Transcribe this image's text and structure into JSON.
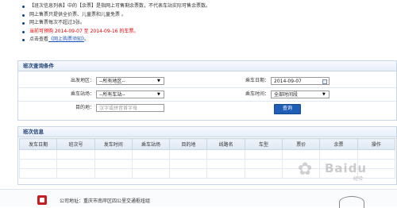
{
  "notices": [
    {
      "text": "【班次信息列表】中的【余票】是指网上可售剩余票数，不代表车站实际可售余票数。",
      "style": "normal"
    },
    {
      "text": "网上售票只提供全价票、儿童票和儿童免票 。",
      "style": "normal"
    },
    {
      "text": "网上售票每次不超过3张。",
      "style": "normal"
    },
    {
      "text": "当前可预购 2014-09-07 至 2014-09-16 的车票。",
      "style": "red"
    },
    {
      "prefix": "点击查看",
      "link": "《网上购票须知》",
      "suffix": "。",
      "style": "link"
    }
  ],
  "query": {
    "title": "班次查询条件",
    "origin_label": "出发地区：",
    "origin_value": "--所有地区--",
    "date_label": "乘车日期：",
    "date_value": "2014-09-07",
    "station_label": "乘车站场：",
    "station_value": "--所有车站--",
    "time_label": "乘车时间：",
    "time_value": "全部时间段",
    "dest_label": "目的地：",
    "dest_placeholder": "汉字或拼音首字母",
    "submit_label": "查询"
  },
  "trains": {
    "title": "班次信息",
    "columns": [
      "发车日期",
      "班次号",
      "发车时间",
      "乘车站场",
      "目的地",
      "线路名",
      "车型",
      "票价",
      "余票",
      "操作"
    ],
    "empty_rows": 3
  },
  "footer": {
    "address": "公司地址：重庆市南岸区四公里交通枢纽组"
  },
  "watermark": {
    "brand": "Baidu",
    "sub": "经验"
  },
  "colors": {
    "accent": "#1f5eb6",
    "panel_border": "#c9d6e6",
    "notice_red": "#e00000",
    "link": "#1a4fbf"
  }
}
